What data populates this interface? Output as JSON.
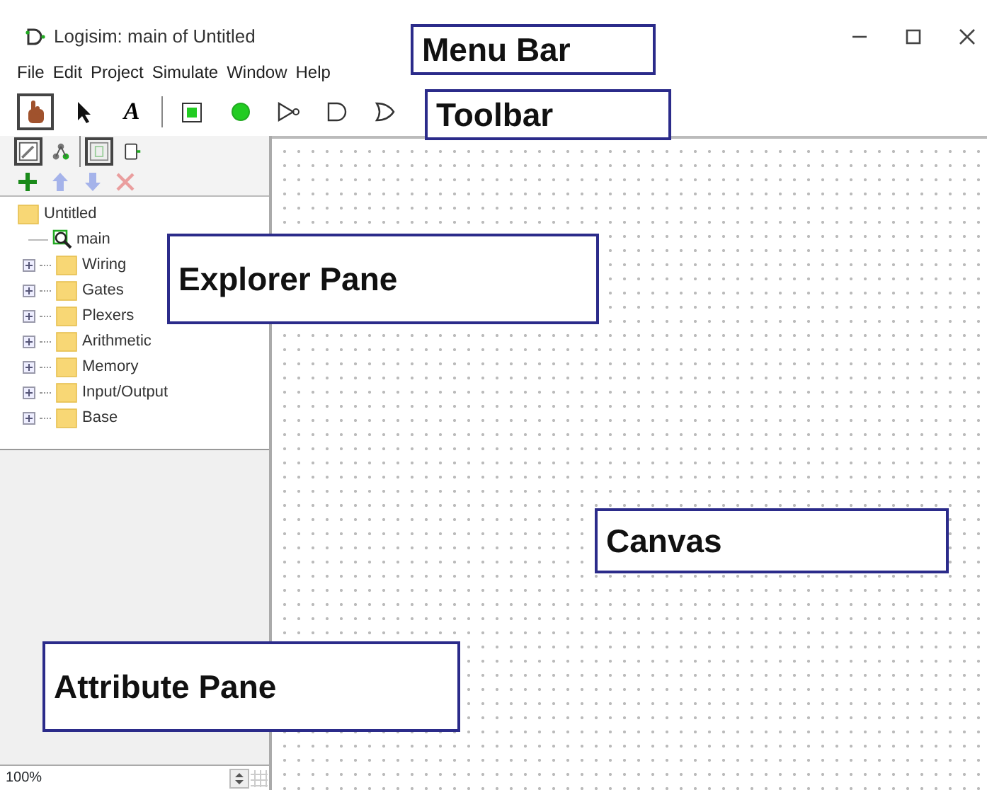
{
  "window": {
    "title": "Logisim: main of Untitled"
  },
  "menu": [
    "File",
    "Edit",
    "Project",
    "Simulate",
    "Window",
    "Help"
  ],
  "toolbar": [
    {
      "kind": "hand",
      "selected": true
    },
    {
      "kind": "arrow",
      "selected": false
    },
    {
      "kind": "text",
      "glyph": "A",
      "selected": false
    },
    {
      "kind": "separator"
    },
    {
      "kind": "pin-in",
      "selected": false
    },
    {
      "kind": "pin-out",
      "selected": false
    },
    {
      "kind": "not-gate",
      "selected": false
    },
    {
      "kind": "and-gate",
      "selected": false
    },
    {
      "kind": "or-gate",
      "selected": false
    }
  ],
  "explorer_toolbar": [
    {
      "kind": "toolbox",
      "selected": true
    },
    {
      "kind": "simulation",
      "selected": false
    },
    {
      "kind": "separator"
    },
    {
      "kind": "layout",
      "selected": true
    },
    {
      "kind": "appearance",
      "selected": false
    }
  ],
  "explorer_actions": [
    {
      "kind": "add",
      "disabled": false
    },
    {
      "kind": "up",
      "disabled": true
    },
    {
      "kind": "down",
      "disabled": true
    },
    {
      "kind": "delete",
      "disabled": true
    }
  ],
  "explorer": {
    "label": "Untitled",
    "kind": "project",
    "children": [
      {
        "label": "main",
        "kind": "circuit"
      },
      {
        "label": "Wiring",
        "kind": "library",
        "expanded": false
      },
      {
        "label": "Gates",
        "kind": "library",
        "expanded": false
      },
      {
        "label": "Plexers",
        "kind": "library",
        "expanded": false
      },
      {
        "label": "Arithmetic",
        "kind": "library",
        "expanded": false
      },
      {
        "label": "Memory",
        "kind": "library",
        "expanded": false
      },
      {
        "label": "Input/Output",
        "kind": "library",
        "expanded": false
      },
      {
        "label": "Base",
        "kind": "library",
        "expanded": false
      }
    ]
  },
  "zoom": {
    "value": "100%"
  },
  "callouts": [
    {
      "label": "Menu Bar"
    },
    {
      "label": "Toolbar"
    },
    {
      "label": "Explorer Pane"
    },
    {
      "label": "Canvas"
    },
    {
      "label": "Attribute Pane"
    }
  ]
}
